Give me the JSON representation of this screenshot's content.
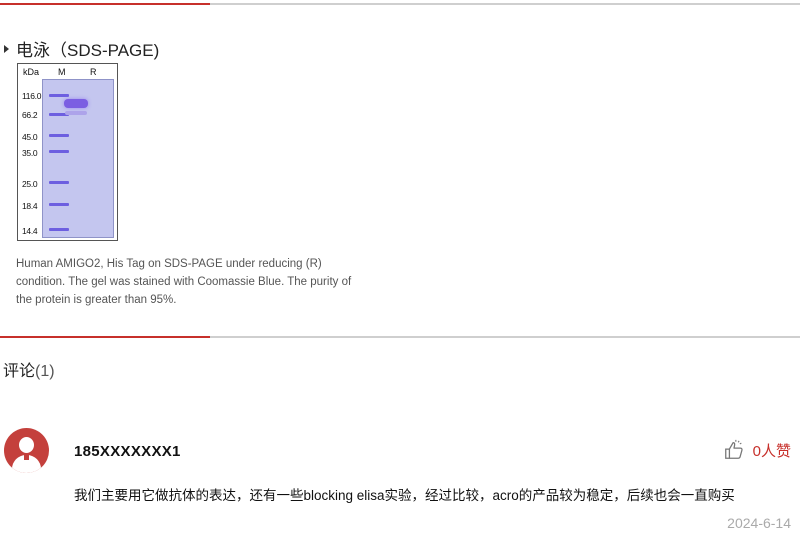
{
  "section": {
    "title": "电泳（SDS-PAGE)"
  },
  "gel": {
    "unit_label": "kDa",
    "lane_marker": "M",
    "lane_sample": "R",
    "mw_labels": [
      "116.0",
      "66.2",
      "45.0",
      "35.0",
      "25.0",
      "18.4",
      "14.4"
    ]
  },
  "caption": "Human AMIGO2, His Tag on SDS-PAGE under reducing (R) condition. The gel was stained with Coomassie Blue. The purity of the protein is greater than 95%.",
  "comments_section": {
    "label": "评论",
    "count": "(1)"
  },
  "comment": {
    "username": "185XXXXXXX1",
    "likes": "0人赞",
    "text": "我们主要用它做抗体的表达，还有一些blocking elisa实验，经过比较，acro的产品较为稳定，后续也会一直购买",
    "date": "2024-6-14"
  },
  "colors": {
    "accent": "#c7302b",
    "avatar": "#c4403c",
    "gel_background": "#c4c6ef",
    "band": "#6d5fe0"
  },
  "icons": {
    "bullet": "triangle-right",
    "avatar": "user-silhouette",
    "like": "thumbs-up-outline"
  }
}
